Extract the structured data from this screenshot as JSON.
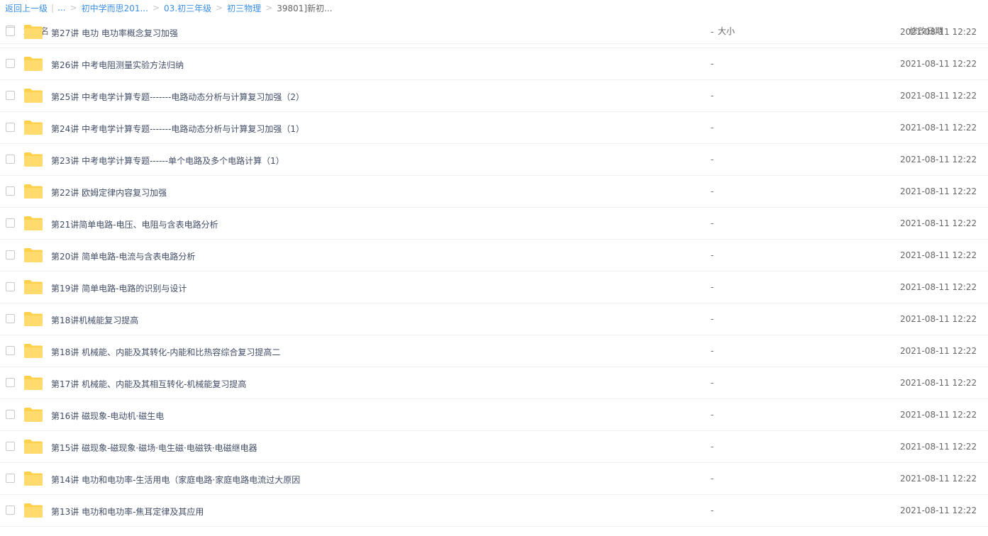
{
  "breadcrumb": {
    "back": "返回上一级",
    "ellipsis": "...",
    "items": [
      "初中学而思201...",
      "03.初三年级",
      "初三物理"
    ],
    "current": "39801]新初..."
  },
  "header": {
    "name": "文件名",
    "size": "大小",
    "date": "修改日期"
  },
  "colors": {
    "link": "#3a8ee6",
    "folder": "#ffd04b"
  },
  "files": [
    {
      "name": "第27讲 电功 电功率概念复习加强",
      "size": "-",
      "date": "2021-08-11 12:22"
    },
    {
      "name": "第26讲 中考电阻测量实验方法归纳",
      "size": "-",
      "date": "2021-08-11 12:22"
    },
    {
      "name": "第25讲 中考电学计算专题-------电路动态分析与计算复习加强（2）",
      "size": "-",
      "date": "2021-08-11 12:22"
    },
    {
      "name": "第24讲 中考电学计算专题-------电路动态分析与计算复习加强（1）",
      "size": "-",
      "date": "2021-08-11 12:22"
    },
    {
      "name": "第23讲 中考电学计算专题------单个电路及多个电路计算（1）",
      "size": "-",
      "date": "2021-08-11 12:22"
    },
    {
      "name": "第22讲 欧姆定律内容复习加强",
      "size": "-",
      "date": "2021-08-11 12:22"
    },
    {
      "name": "第21讲简单电路-电压、电阻与含表电路分析",
      "size": "-",
      "date": "2021-08-11 12:22"
    },
    {
      "name": "第20讲 简单电路-电流与含表电路分析",
      "size": "-",
      "date": "2021-08-11 12:22"
    },
    {
      "name": "第19讲 简单电路-电路的识别与设计",
      "size": "-",
      "date": "2021-08-11 12:22"
    },
    {
      "name": "第18讲机械能复习提高",
      "size": "-",
      "date": "2021-08-11 12:22"
    },
    {
      "name": "第18讲 机械能、内能及其转化-内能和比热容综合复习提高二",
      "size": "-",
      "date": "2021-08-11 12:22"
    },
    {
      "name": "第17讲 机械能、内能及其相互转化-机械能复习提高",
      "size": "-",
      "date": "2021-08-11 12:22"
    },
    {
      "name": "第16讲 磁现象-电动机·磁生电",
      "size": "-",
      "date": "2021-08-11 12:22"
    },
    {
      "name": "第15讲 磁现象-磁现象·磁场·电生磁·电磁铁·电磁继电器",
      "size": "-",
      "date": "2021-08-11 12:22"
    },
    {
      "name": "第14讲 电功和电功率-生活用电（家庭电路·家庭电路电流过大原因",
      "size": "-",
      "date": "2021-08-11 12:22"
    },
    {
      "name": "第13讲 电功和电功率-焦耳定律及其应用",
      "size": "-",
      "date": "2021-08-11 12:22"
    }
  ]
}
